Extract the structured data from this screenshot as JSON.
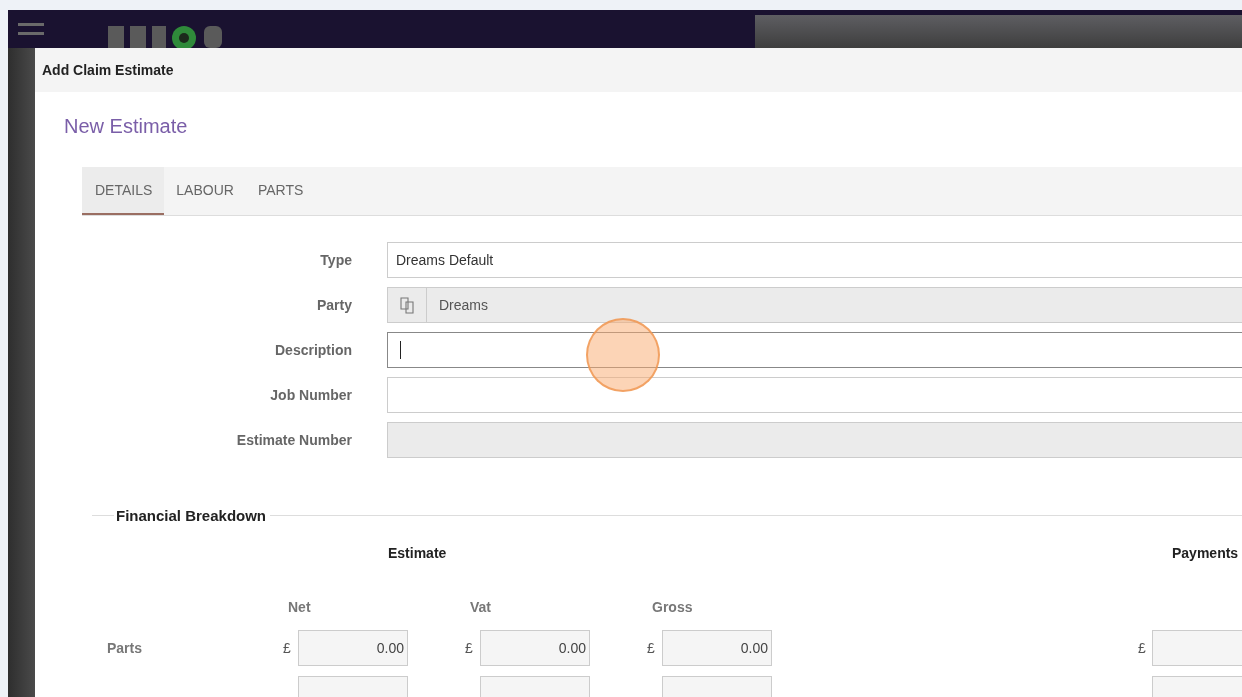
{
  "window": {
    "title": "Add Claim Estimate"
  },
  "heading": "New Estimate",
  "tabs": [
    {
      "label": "DETAILS",
      "selected": true
    },
    {
      "label": "LABOUR",
      "selected": false
    },
    {
      "label": "PARTS",
      "selected": false
    }
  ],
  "fields": [
    {
      "label": "Type",
      "kind": "text",
      "value": "Dreams Default",
      "disabled": false,
      "focused": false
    },
    {
      "label": "Party",
      "kind": "party",
      "value": "Dreams",
      "disabled": true,
      "focused": false
    },
    {
      "label": "Description",
      "kind": "text",
      "disabled": false,
      "focused": true
    },
    {
      "label": "Job Number",
      "kind": "text",
      "disabled": false,
      "focused": false
    },
    {
      "label": "Estimate Number",
      "kind": "text",
      "disabled": true,
      "focused": false
    }
  ],
  "financial_breakdown": {
    "title": "Financial Breakdown",
    "estimate_heading": "Estimate",
    "payments_heading": "Payments",
    "columns": [
      "Net",
      "Vat",
      "Gross"
    ],
    "rows": [
      {
        "label": "Parts",
        "cells": [
          {
            "currency": "£",
            "value": "0.00"
          },
          {
            "currency": "£",
            "value": "0.00"
          },
          {
            "currency": "£",
            "value": "0.00"
          }
        ],
        "payment": {
          "currency": "£"
        }
      },
      {
        "cells": [
          {},
          {},
          {}
        ],
        "payment": {}
      }
    ]
  }
}
